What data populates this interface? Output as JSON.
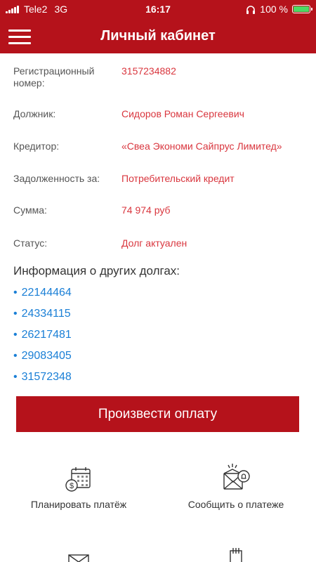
{
  "status_bar": {
    "carrier": "Tele2",
    "network": "3G",
    "time": "16:17",
    "battery_text": "100 %"
  },
  "header": {
    "title": "Личный кабинет"
  },
  "details": [
    {
      "label": "Регистрационный номер:",
      "value": "3157234882"
    },
    {
      "label": "Должник:",
      "value": "Сидоров Роман Сергеевич"
    },
    {
      "label": "Кредитор:",
      "value": "«Свеа Экономи Сайпрус Лимитед»"
    },
    {
      "label": "Задолженность за:",
      "value": "Потребительский кредит"
    },
    {
      "label": "Сумма:",
      "value": "74 974 руб"
    },
    {
      "label": "Статус:",
      "value": "Долг актуален"
    }
  ],
  "other_debts": {
    "title": "Информация о других долгах:",
    "items": [
      "22144464",
      "24334115",
      "26217481",
      "29083405",
      "31572348"
    ]
  },
  "pay_button": "Произвести оплату",
  "actions": [
    {
      "label": "Планировать платёж",
      "icon": "calendar-dollar-icon"
    },
    {
      "label": "Сообщить о платеже",
      "icon": "envelope-bell-icon"
    }
  ],
  "colors": {
    "brand_red": "#b5121b",
    "value_red": "#d9363e",
    "link_blue": "#1a7fd6"
  }
}
